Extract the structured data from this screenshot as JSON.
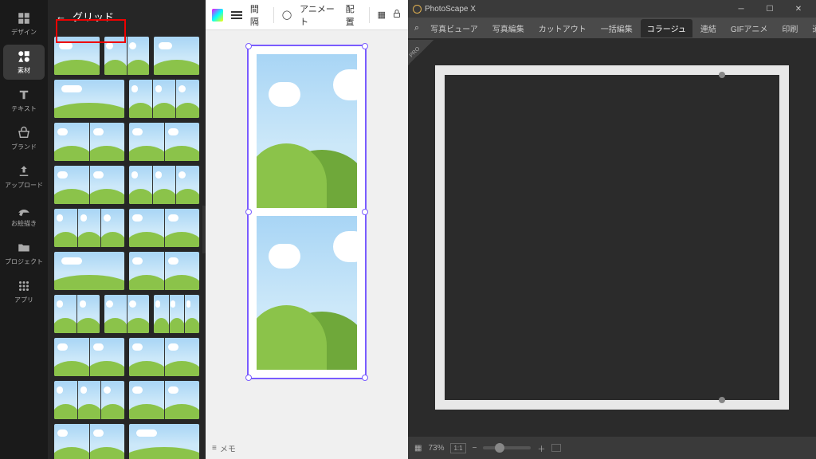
{
  "left": {
    "panel_title": "グリッド",
    "toolstrip": [
      {
        "label": "デザイン",
        "name": "design"
      },
      {
        "label": "素材",
        "name": "elements"
      },
      {
        "label": "テキスト",
        "name": "text"
      },
      {
        "label": "ブランド",
        "name": "brand"
      },
      {
        "label": "アップロード",
        "name": "upload"
      },
      {
        "label": "お絵描き",
        "name": "draw"
      },
      {
        "label": "プロジェクト",
        "name": "projects"
      },
      {
        "label": "アプリ",
        "name": "apps"
      }
    ],
    "topbar": {
      "spacing": "間隔",
      "animate": "アニメート",
      "position": "配置"
    },
    "memo": "メモ"
  },
  "right": {
    "title": "PhotoScape X",
    "tabs": [
      "写真ビューア",
      "写真編集",
      "カットアウト",
      "一括編集",
      "コラージュ",
      "連結",
      "GIFアニメ",
      "印刷",
      "道具"
    ],
    "active_tab": "コラージュ",
    "zoom": "73%",
    "ratio": "1:1"
  }
}
